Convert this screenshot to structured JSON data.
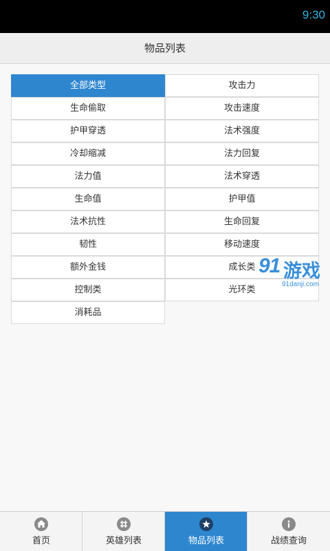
{
  "status_bar": {
    "time": "9:30"
  },
  "header": {
    "title": "物品列表"
  },
  "categories": [
    "全部类型",
    "攻击力",
    "生命偷取",
    "攻击速度",
    "护甲穿透",
    "法术强度",
    "冷却缩减",
    "法力回复",
    "法力值",
    "法术穿透",
    "生命值",
    "护甲值",
    "法术抗性",
    "生命回复",
    "韧性",
    "移动速度",
    "额外金钱",
    "成长类",
    "控制类",
    "光环类",
    "消耗品"
  ],
  "selected_category": "全部类型",
  "watermark": {
    "mark": "91",
    "name": "游戏",
    "site": "91danji.com"
  },
  "tabs": [
    {
      "label": "首页",
      "icon": "home-icon"
    },
    {
      "label": "英雄列表",
      "icon": "grid-icon"
    },
    {
      "label": "物品列表",
      "icon": "star-icon"
    },
    {
      "label": "战绩查询",
      "icon": "info-icon"
    }
  ],
  "active_tab": "物品列表",
  "colors": {
    "accent": "#2e86cf",
    "status_time": "#35b5e5",
    "watermark": "#3a8fd9"
  }
}
